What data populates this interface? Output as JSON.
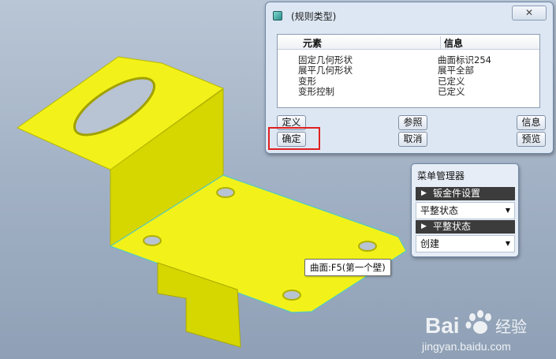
{
  "dialog": {
    "title": "(规则类型)",
    "close_symbol": "✕",
    "headers": {
      "element": "元素",
      "info": "信息"
    },
    "rows": [
      {
        "element": "固定几何形状",
        "info": "曲面标识254"
      },
      {
        "element": "展平几何形状",
        "info": "展平全部"
      },
      {
        "element": "变形",
        "info": "已定义"
      },
      {
        "element": "变形控制",
        "info": "已定义"
      }
    ],
    "buttons": {
      "define": "定义",
      "reference": "参照",
      "info": "信息",
      "ok": "确定",
      "cancel": "取消",
      "preview": "预览"
    }
  },
  "menu_manager": {
    "title": "菜单管理器",
    "sections": [
      {
        "label": "钣金件设置",
        "item": "平整状态"
      },
      {
        "label": "平整状态",
        "item": "创建"
      }
    ]
  },
  "tooltip": "曲面:F5(第一个壁)",
  "watermark": {
    "brand": "Bai 经验",
    "url": "jingyan.baidu.com"
  },
  "colors": {
    "part_yellow": "#f2f21a",
    "highlight": "#e02020",
    "background": "#a9b8ca"
  }
}
